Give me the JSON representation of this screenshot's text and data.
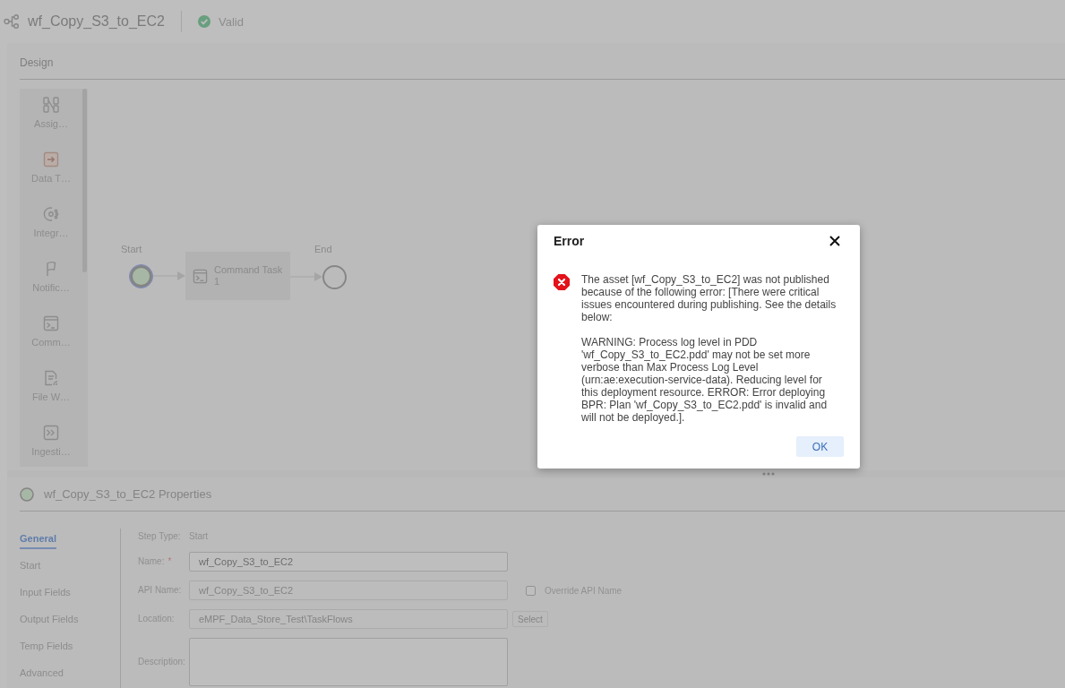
{
  "header": {
    "title": "wf_Copy_S3_to_EC2",
    "status": "Valid"
  },
  "design": {
    "tab": "Design",
    "palette": [
      {
        "kind": "assignment",
        "label": "Assig…"
      },
      {
        "kind": "data_task",
        "label": "Data T…"
      },
      {
        "kind": "integration",
        "label": "Integr…"
      },
      {
        "kind": "notification",
        "label": "Notific…"
      },
      {
        "kind": "command",
        "label": "Comm…"
      },
      {
        "kind": "file_watch",
        "label": "File W…"
      },
      {
        "kind": "ingestion",
        "label": "Ingesti…"
      }
    ],
    "canvas": {
      "start": {
        "label": "Start",
        "selected": true
      },
      "task": {
        "label": "Command Task 1"
      },
      "end": {
        "label": "End"
      }
    }
  },
  "properties": {
    "title": "wf_Copy_S3_to_EC2 Properties",
    "nav": [
      {
        "label": "General",
        "selected": true
      },
      {
        "label": "Start",
        "selected": false
      },
      {
        "label": "Input Fields",
        "selected": false
      },
      {
        "label": "Output Fields",
        "selected": false
      },
      {
        "label": "Temp Fields",
        "selected": false
      },
      {
        "label": "Advanced",
        "selected": false
      }
    ],
    "step_type": {
      "label": "Step Type:",
      "value": "Start"
    },
    "fields": [
      {
        "kind": "input",
        "label": "Name:",
        "required_mark": "*",
        "value": "wf_Copy_S3_to_EC2",
        "disabled": false
      },
      {
        "kind": "input",
        "label": "API Name:",
        "value": "wf_Copy_S3_to_EC2",
        "disabled": true,
        "checkbox": {
          "label": "Override API Name",
          "checked": false
        }
      },
      {
        "kind": "input",
        "label": "Location:",
        "value": "eMPF_Data_Store_Test\\TaskFlows",
        "disabled": true,
        "button": {
          "label": "Select",
          "disabled": true
        }
      },
      {
        "kind": "textarea",
        "label": "Description:"
      }
    ]
  },
  "dialog": {
    "title": "Error",
    "message": [
      "The asset [wf_Copy_S3_to_EC2] was not published because of the following error: [There were critical issues encountered during publishing. See the details below:",
      "WARNING: Process log level in PDD 'wf_Copy_S3_to_EC2.pdd' may not be set more verbose than Max Process Log Level (urn:ae:execution-service-data). Reducing level for this deployment resource. ERROR: Error deploying BPR: Plan 'wf_Copy_S3_to_EC2.pdd' is invalid and will not be deployed.]."
    ],
    "button": "OK"
  }
}
